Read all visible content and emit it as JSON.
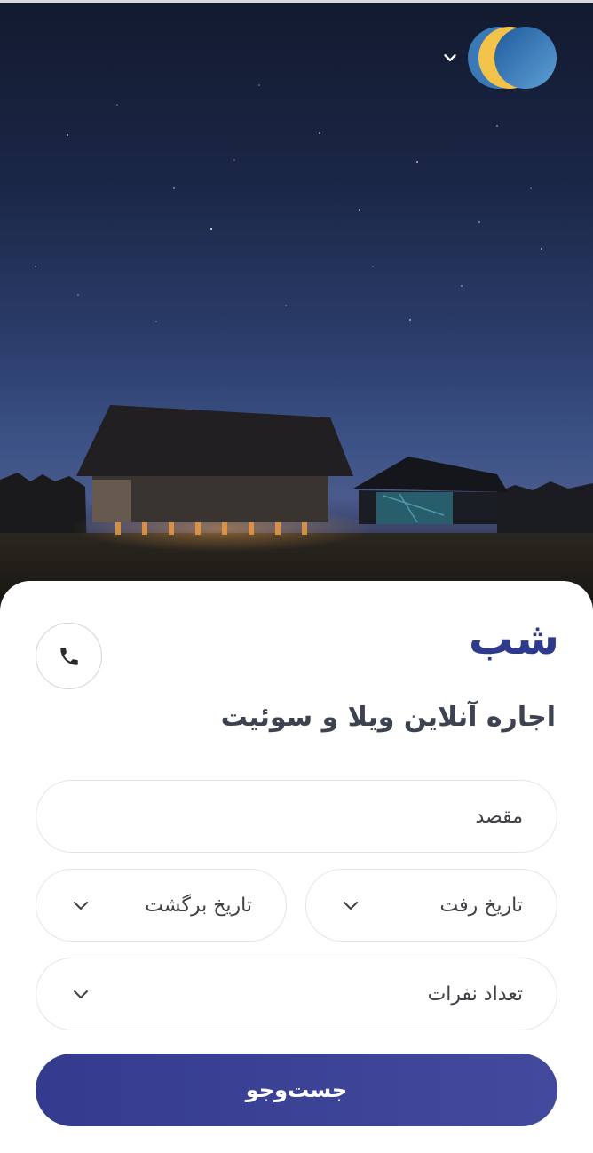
{
  "header": {
    "logo_icon": "moon-logo-icon",
    "menu_toggle_icon": "chevron-down-icon"
  },
  "brand": {
    "wordmark": "شب",
    "tagline": "اجاره آنلاین ویلا و سوئیت"
  },
  "contact": {
    "icon": "phone-icon"
  },
  "search": {
    "destination_placeholder": "مقصد",
    "depart_date_label": "تاریخ رفت",
    "return_date_label": "تاریخ برگشت",
    "guests_label": "تعداد نفرات",
    "submit_label": "جست‌وجو"
  },
  "colors": {
    "brand_primary": "#2e3a8c",
    "button_start": "#343b8f",
    "button_end": "#434a9e",
    "logo_gold": "#f3c24b",
    "logo_blue": "#3f7fbf"
  }
}
